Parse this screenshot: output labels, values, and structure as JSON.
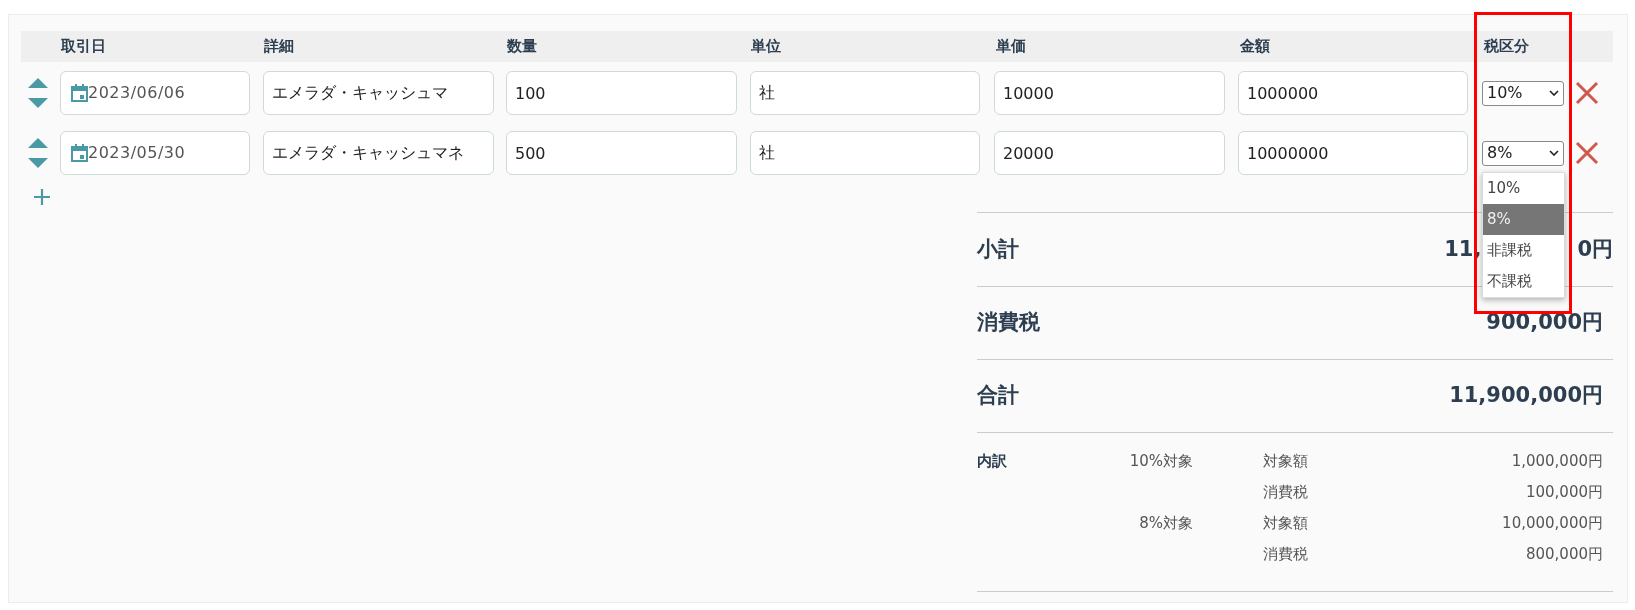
{
  "table": {
    "columns": [
      "取引日",
      "詳細",
      "数量",
      "単位",
      "単価",
      "金額",
      "税区分"
    ],
    "rows": [
      {
        "date": "2023/06/06",
        "detail": "エメラダ・キャッシュマ",
        "quantity": "100",
        "unit": "社",
        "unit_price": "10000",
        "amount": "1000000",
        "tax_category": "10%"
      },
      {
        "date": "2023/05/30",
        "detail": "エメラダ・キャッシュマネ",
        "quantity": "500",
        "unit": "社",
        "unit_price": "20000",
        "amount": "10000000",
        "tax_category": "8%"
      }
    ]
  },
  "tax_dropdown": {
    "options": [
      {
        "label": "10%",
        "selected": false
      },
      {
        "label": "8%",
        "selected": true
      },
      {
        "label": "非課税",
        "selected": false
      },
      {
        "label": "不課税",
        "selected": false
      }
    ]
  },
  "summary": {
    "subtotal": {
      "label": "小計",
      "value_visible_start": "11,",
      "value_visible_end": "0円"
    },
    "tax": {
      "label": "消費税",
      "value": "900,000円"
    },
    "total": {
      "label": "合計",
      "value": "11,900,000円"
    },
    "breakdown": {
      "label": "内訳",
      "groups": [
        {
          "rate": "10%対象",
          "lines": [
            {
              "label": "対象額",
              "value": "1,000,000円"
            },
            {
              "label": "消費税",
              "value": "100,000円"
            }
          ]
        },
        {
          "rate": "8%対象",
          "lines": [
            {
              "label": "対象額",
              "value": "10,000,000円"
            },
            {
              "label": "消費税",
              "value": "800,000円"
            }
          ]
        }
      ]
    }
  }
}
